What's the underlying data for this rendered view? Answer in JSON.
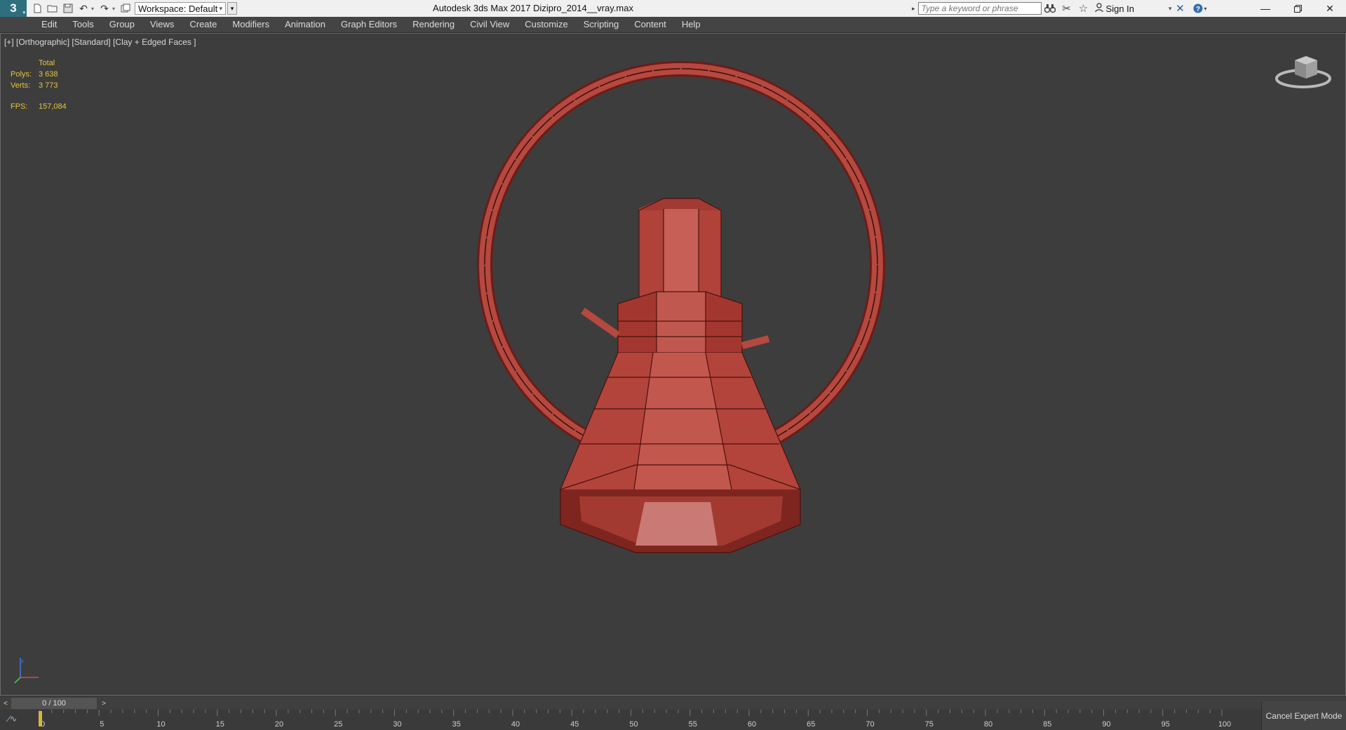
{
  "titlebar": {
    "app_logo_text": "3",
    "workspace_label": "Workspace: Default",
    "window_title": "Autodesk 3ds Max 2017    Dizipro_2014__vray.max",
    "search_placeholder": "Type a keyword or phrase",
    "signin_label": "Sign In",
    "icons": [
      "new-file-icon",
      "open-file-icon",
      "save-icon",
      "undo-icon",
      "redo-icon",
      "project-folder-icon",
      "binoculars-icon",
      "tools-icon",
      "star-icon",
      "user-icon",
      "exchange-icon",
      "help-icon",
      "minimize-icon",
      "restore-icon",
      "close-icon"
    ]
  },
  "menu": [
    "Edit",
    "Tools",
    "Group",
    "Views",
    "Create",
    "Modifiers",
    "Animation",
    "Graph Editors",
    "Rendering",
    "Civil View",
    "Customize",
    "Scripting",
    "Content",
    "Help"
  ],
  "viewport": {
    "label": "[+] [Orthographic] [Standard] [Clay + Edged Faces ]",
    "stats": {
      "header": "Total",
      "polys_label": "Polys:",
      "polys_value": "3 638",
      "verts_label": "Verts:",
      "verts_value": "3 773",
      "fps_label": "FPS:",
      "fps_value": "157,084"
    },
    "model_color": "#b5483f",
    "background_color": "#3d3d3d"
  },
  "timeline": {
    "slider_text": "0 / 100",
    "current_frame": 0,
    "total_frames": 100,
    "ruler_labels": [
      "0",
      "5",
      "10",
      "15",
      "20",
      "25",
      "30",
      "35",
      "40",
      "45",
      "50",
      "55",
      "60",
      "65",
      "70",
      "75",
      "80",
      "85",
      "90",
      "95",
      "100"
    ],
    "cancel_expert_label": "Cancel Expert Mode"
  }
}
